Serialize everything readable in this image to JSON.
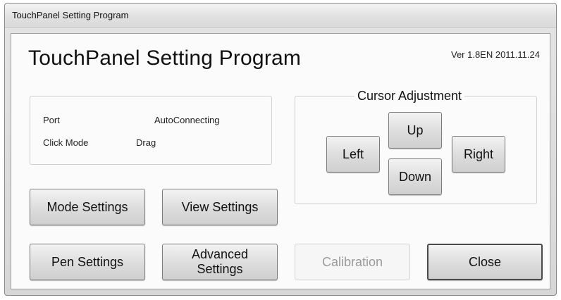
{
  "window": {
    "title": "TouchPanel Setting Program"
  },
  "header": {
    "title": "TouchPanel Setting Program",
    "version": "Ver 1.8EN 2011.11.24"
  },
  "info": {
    "port_label": "Port",
    "port_value": "AutoConnecting",
    "click_mode_label": "Click Mode",
    "click_mode_value": "Drag"
  },
  "cursor": {
    "title": "Cursor Adjustment",
    "up": "Up",
    "left": "Left",
    "right": "Right",
    "down": "Down"
  },
  "buttons": {
    "mode_settings": "Mode Settings",
    "view_settings": "View Settings",
    "pen_settings": "Pen Settings",
    "advanced_line1": "Advanced",
    "advanced_line2": "Settings",
    "calibration": "Calibration",
    "close": "Close"
  },
  "states": {
    "calibration_enabled": false,
    "default_button": "close"
  }
}
